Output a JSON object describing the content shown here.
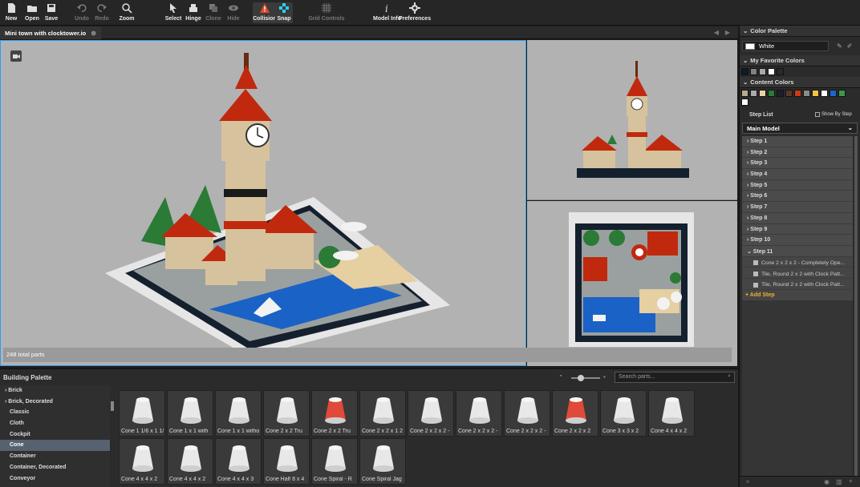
{
  "toolbar": [
    {
      "label": "New",
      "icon": "new-file-icon",
      "enabled": true
    },
    {
      "label": "Open",
      "icon": "folder-icon",
      "enabled": true
    },
    {
      "label": "Save",
      "icon": "save-icon",
      "enabled": true
    },
    {
      "label": "Undo",
      "icon": "undo-icon",
      "enabled": false
    },
    {
      "label": "Redo",
      "icon": "redo-icon",
      "enabled": false
    },
    {
      "label": "Zoom",
      "icon": "zoom-icon",
      "enabled": true
    },
    {
      "label": "Select",
      "icon": "cursor-icon",
      "enabled": true
    },
    {
      "label": "Hinge",
      "icon": "hinge-icon",
      "enabled": true
    },
    {
      "label": "Clone",
      "icon": "clone-icon",
      "enabled": false
    },
    {
      "label": "Hide",
      "icon": "eye-icon",
      "enabled": false
    },
    {
      "label": "Collision",
      "icon": "warning-icon",
      "enabled": true
    },
    {
      "label": "Snap",
      "icon": "snap-icon",
      "enabled": true
    },
    {
      "label": "Grid Controls",
      "icon": "grid-icon",
      "enabled": false
    },
    {
      "label": "Model Info",
      "icon": "info-icon",
      "enabled": true
    },
    {
      "label": "Preferences",
      "icon": "gear-icon",
      "enabled": true
    }
  ],
  "document": {
    "tab_title": "Mini town with clocktower.io",
    "status": "248 total parts"
  },
  "color_palette": {
    "title": "Color Palette",
    "selected_name": "White",
    "selected_hex": "#ffffff",
    "favorites_title": "My Favorite Colors",
    "favorites": [
      "#0d1b2a",
      "#7e8280",
      "#a7a9a8",
      "#ffffff",
      "#2a2a2a"
    ],
    "content_title": "Content Colors",
    "content": [
      "#b9a98d",
      "#aaaaaa",
      "#e8d3a8",
      "#2a7a3a",
      "#1a1f2a",
      "#5a3a2a",
      "#ce3a16",
      "#8a8a8a",
      "#f2c34a",
      "#ffffff",
      "#1a66cc",
      "#3a9a4a",
      "#ffffff"
    ]
  },
  "step_list": {
    "title": "Step List",
    "show_by_step": "Show By Step",
    "model": "Main Model",
    "steps": [
      "Step 1",
      "Step 2",
      "Step 3",
      "Step 4",
      "Step 5",
      "Step 6",
      "Step 7",
      "Step 8",
      "Step 9",
      "Step 10",
      "Step 11"
    ],
    "step11_parts": [
      "Cone 2 x 2 x 2 - Completely Ope...",
      "Tile, Round 2 x 2 with Clock Patt...",
      "Tile, Round 2 x 2 with Clock Patt..."
    ],
    "add_step": "Add Step"
  },
  "building_palette": {
    "title": "Building Palette",
    "search_placeholder": "Search parts...",
    "categories": [
      "Brick",
      "Brick, Decorated",
      "Classic",
      "Cloth",
      "Cockpit",
      "Cone",
      "Container",
      "Container, Decorated",
      "Conveyor"
    ],
    "selected_category": "Cone",
    "parts": [
      "Cone 1 1/6 x 1 1/",
      "Cone 1 x 1 with",
      "Cone 1 x 1 witho",
      "Cone 2 x 2 Tru",
      "Cone 2 x 2 Tru",
      "Cone 2 x 2 x 1 2",
      "Cone 2 x 2 x 2 -",
      "Cone 2 x 2 x 2 -",
      "Cone 2 x 2 x 2 -",
      "Cone 2 x 2 x 2",
      "Cone 3 x 3 x 2",
      "Cone 4 x 4 x 2",
      "Cone 4 x 4 x 2",
      "Cone 4 x 4 x 2",
      "Cone 4 x 4 x 3",
      "Cone Half 8 x 4",
      "Cone Spiral - R",
      "Cone Spiral Jag"
    ]
  }
}
